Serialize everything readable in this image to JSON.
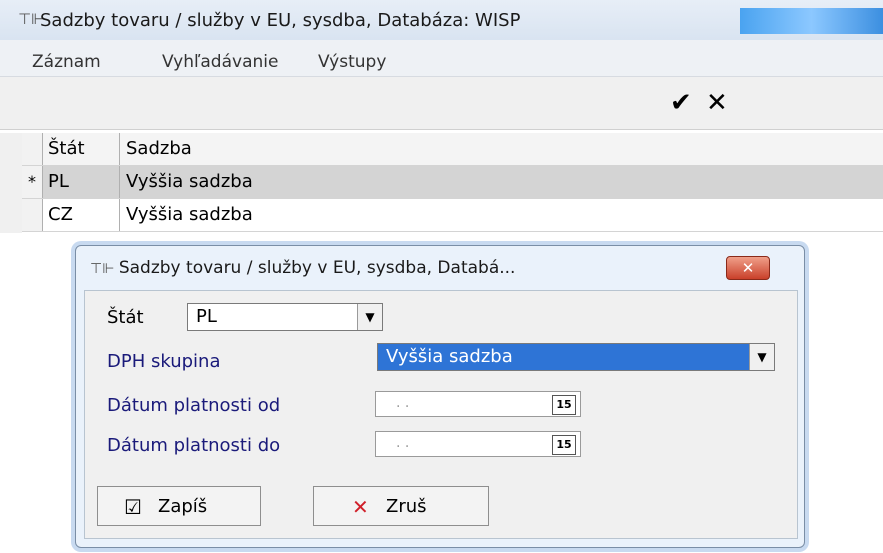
{
  "window": {
    "title": "Sadzby tovaru / služby v  EU, sysdba,  Databáza: WISP",
    "icon": "app-grid-icon"
  },
  "menu": [
    "Záznam",
    "Vyhľadávanie",
    "Výstupy"
  ],
  "toolbar": {
    "confirm_glyph": "✔",
    "cancel_glyph": "✕"
  },
  "grid": {
    "columns": [
      "Štát",
      "Sadzba"
    ],
    "rows": [
      {
        "indicator": "*",
        "stat": "PL",
        "sadzba": "Vyššia sadzba"
      },
      {
        "indicator": "",
        "stat": "CZ",
        "sadzba": "Vyššia sadzba"
      }
    ]
  },
  "dialog": {
    "title": "Sadzby tovaru / služby v  EU, sysdba,  Databá...",
    "close_glyph": "✕",
    "fields": {
      "stat_label": "Štát",
      "stat_value": "PL",
      "dph_label": "DPH skupina",
      "dph_value": "Vyššia sadzba",
      "date_from_label": "Dátum platnosti od",
      "date_to_label": "Dátum platnosti do",
      "date_mask": ". .",
      "calendar_glyph": "15"
    },
    "buttons": {
      "save_label": "Zapíš",
      "save_glyph": "☑",
      "cancel_label": "Zruš",
      "cancel_glyph": "✕"
    }
  },
  "colors": {
    "selection_blue": "#2e74d6",
    "cancel_red": "#d0202a",
    "label_blue": "#1a1a7a"
  }
}
